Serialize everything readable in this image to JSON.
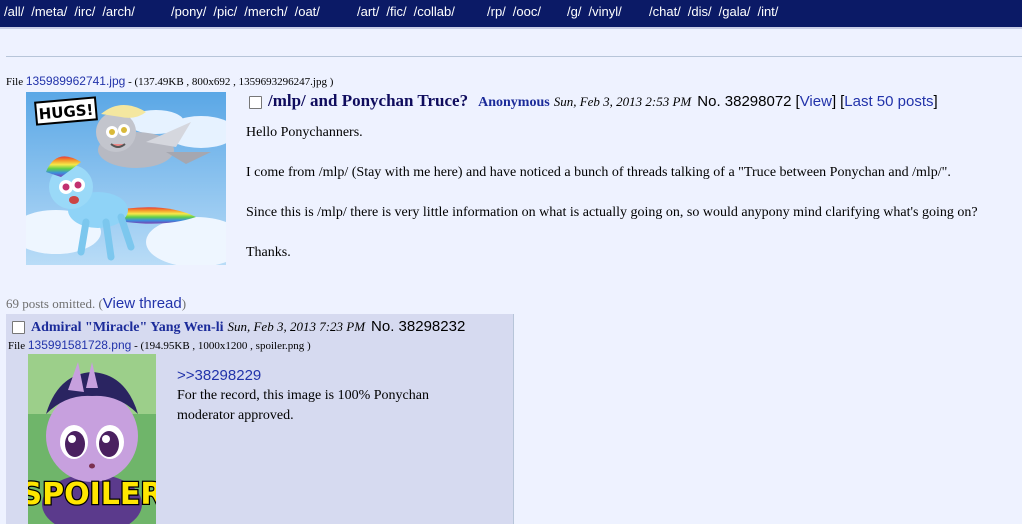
{
  "nav": {
    "group1": [
      "/all/",
      "/meta/",
      "/irc/",
      "/arch/"
    ],
    "group2": [
      "/pony/",
      "/pic/",
      "/merch/",
      "/oat/"
    ],
    "group3": [
      "/art/",
      "/fic/",
      "/collab/"
    ],
    "group4": [
      "/rp/",
      "/ooc/"
    ],
    "group5": [
      "/g/",
      "/vinyl/"
    ],
    "group6": [
      "/chat/",
      "/dis/",
      "/gala/",
      "/int/"
    ]
  },
  "op": {
    "file_label": "File",
    "file_name": "135989962741.jpg",
    "file_meta": " - (137.49KB , 800x692 , 1359693296247.jpg )",
    "image_caption": "HUGS!",
    "subject": "/mlp/ and Ponychan Truce?",
    "name": "Anonymous",
    "date": "Sun, Feb 3, 2013 2:53 PM",
    "post_no": "No. 38298072",
    "view_link": "View",
    "last50_link": "Last 50 posts",
    "lines": [
      "Hello Ponychanners.",
      "I come from /mlp/ (Stay with me here) and have noticed a bunch of threads talking of a \"Truce between Ponychan and /mlp/\".",
      "Since this is /mlp/ there is very little information on what is actually going on, so would anypony mind clarifying what's going on?",
      "Thanks."
    ]
  },
  "omitted": {
    "text": "69 posts omitted. (",
    "link": "View thread",
    "close": ")"
  },
  "reply": {
    "name": "Admiral \"Miracle\" Yang Wen-li",
    "date": "Sun, Feb 3, 2013 7:23 PM",
    "post_no": "No. 38298232",
    "file_label": "File",
    "file_name": "135991581728.png",
    "file_meta": " - (194.95KB , 1000x1200 , spoiler.png )",
    "spoiler_label": "SPOILER",
    "quote": ">>38298229",
    "lines": [
      "For the record, this image is 100% Ponychan",
      "moderator approved."
    ]
  }
}
